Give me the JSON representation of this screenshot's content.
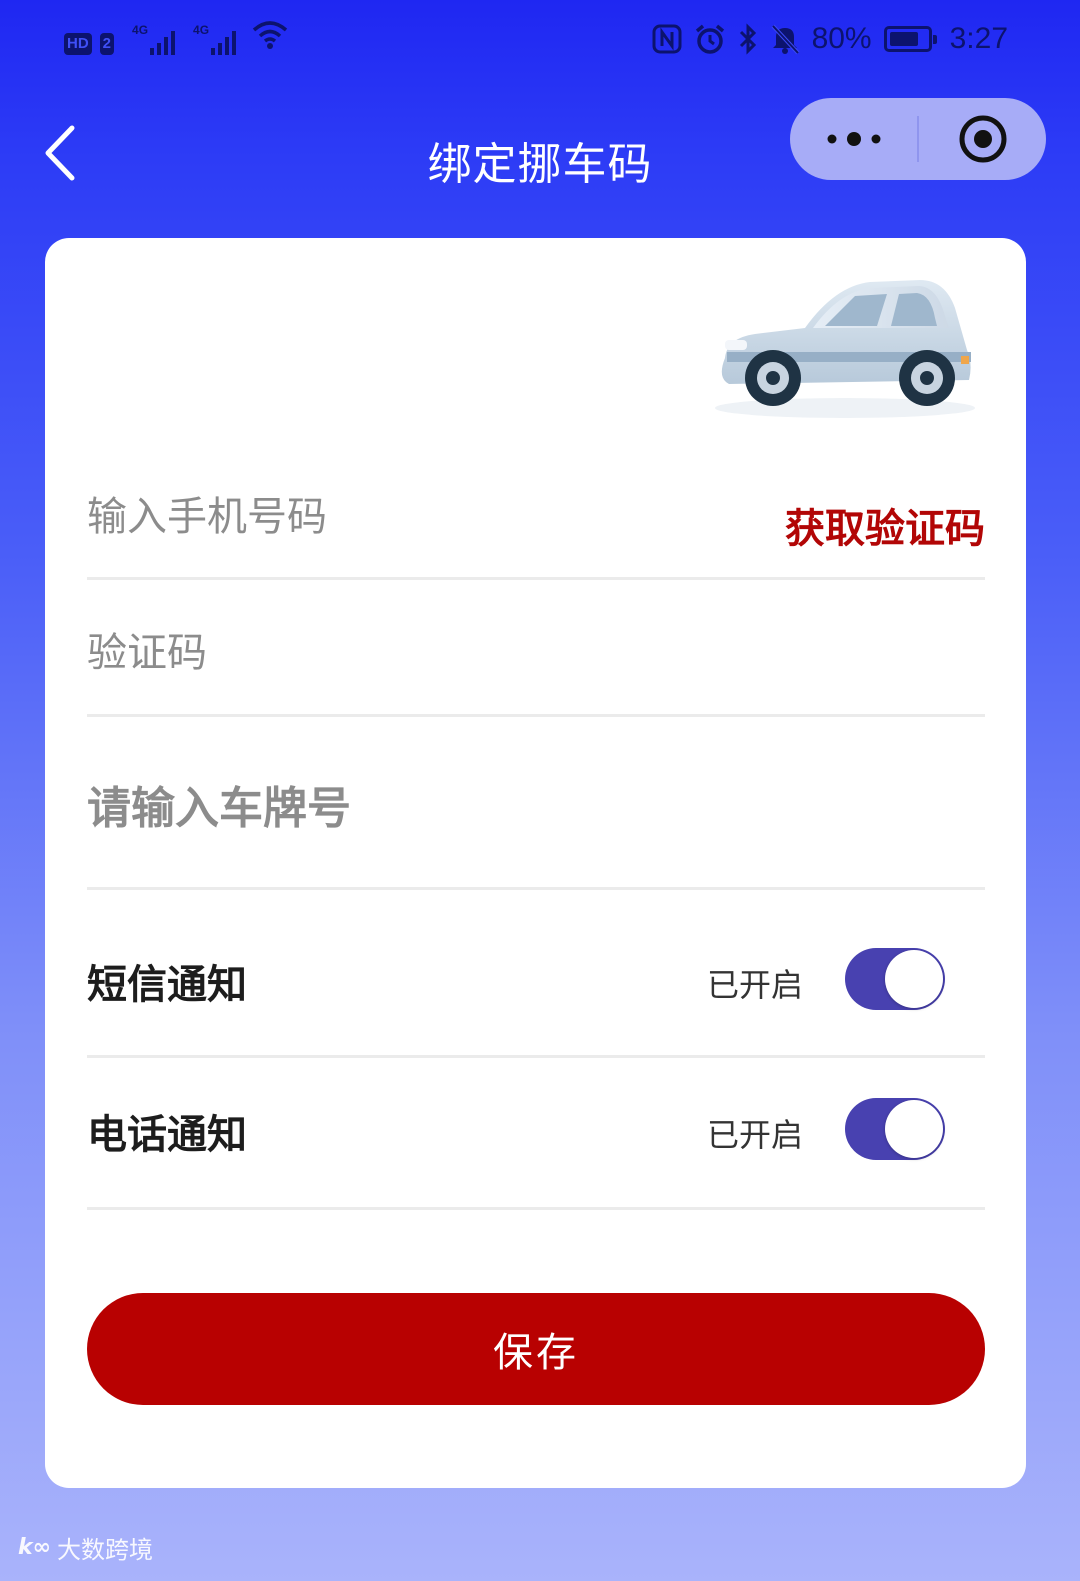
{
  "status_bar": {
    "hd_label": "HD",
    "sim_label": "2",
    "net1_label": "4G",
    "net2_label": "4G",
    "battery_percent": "80%",
    "time": "3:27",
    "battery_level": 0.8,
    "icons": [
      "nfc-icon",
      "alarm-icon",
      "bluetooth-icon",
      "mute-icon",
      "wifi-icon"
    ]
  },
  "nav": {
    "title": "绑定挪车码"
  },
  "form": {
    "phone_placeholder": "输入手机号码",
    "get_code_label": "获取验证码",
    "code_placeholder": "验证码",
    "plate_placeholder": "请输入车牌号",
    "sms_label": "短信通知",
    "sms_status": "已开启",
    "sms_enabled": true,
    "call_label": "电话通知",
    "call_status": "已开启",
    "call_enabled": true,
    "save_label": "保存"
  },
  "watermark": {
    "text": "大数跨境"
  },
  "colors": {
    "background_top": "#1f27f2",
    "background_bottom": "#a9b3fb",
    "accent_red": "#b80101",
    "link_red": "#b20606",
    "toggle_on": "#4841b0",
    "capsule": "#a7acf7"
  }
}
